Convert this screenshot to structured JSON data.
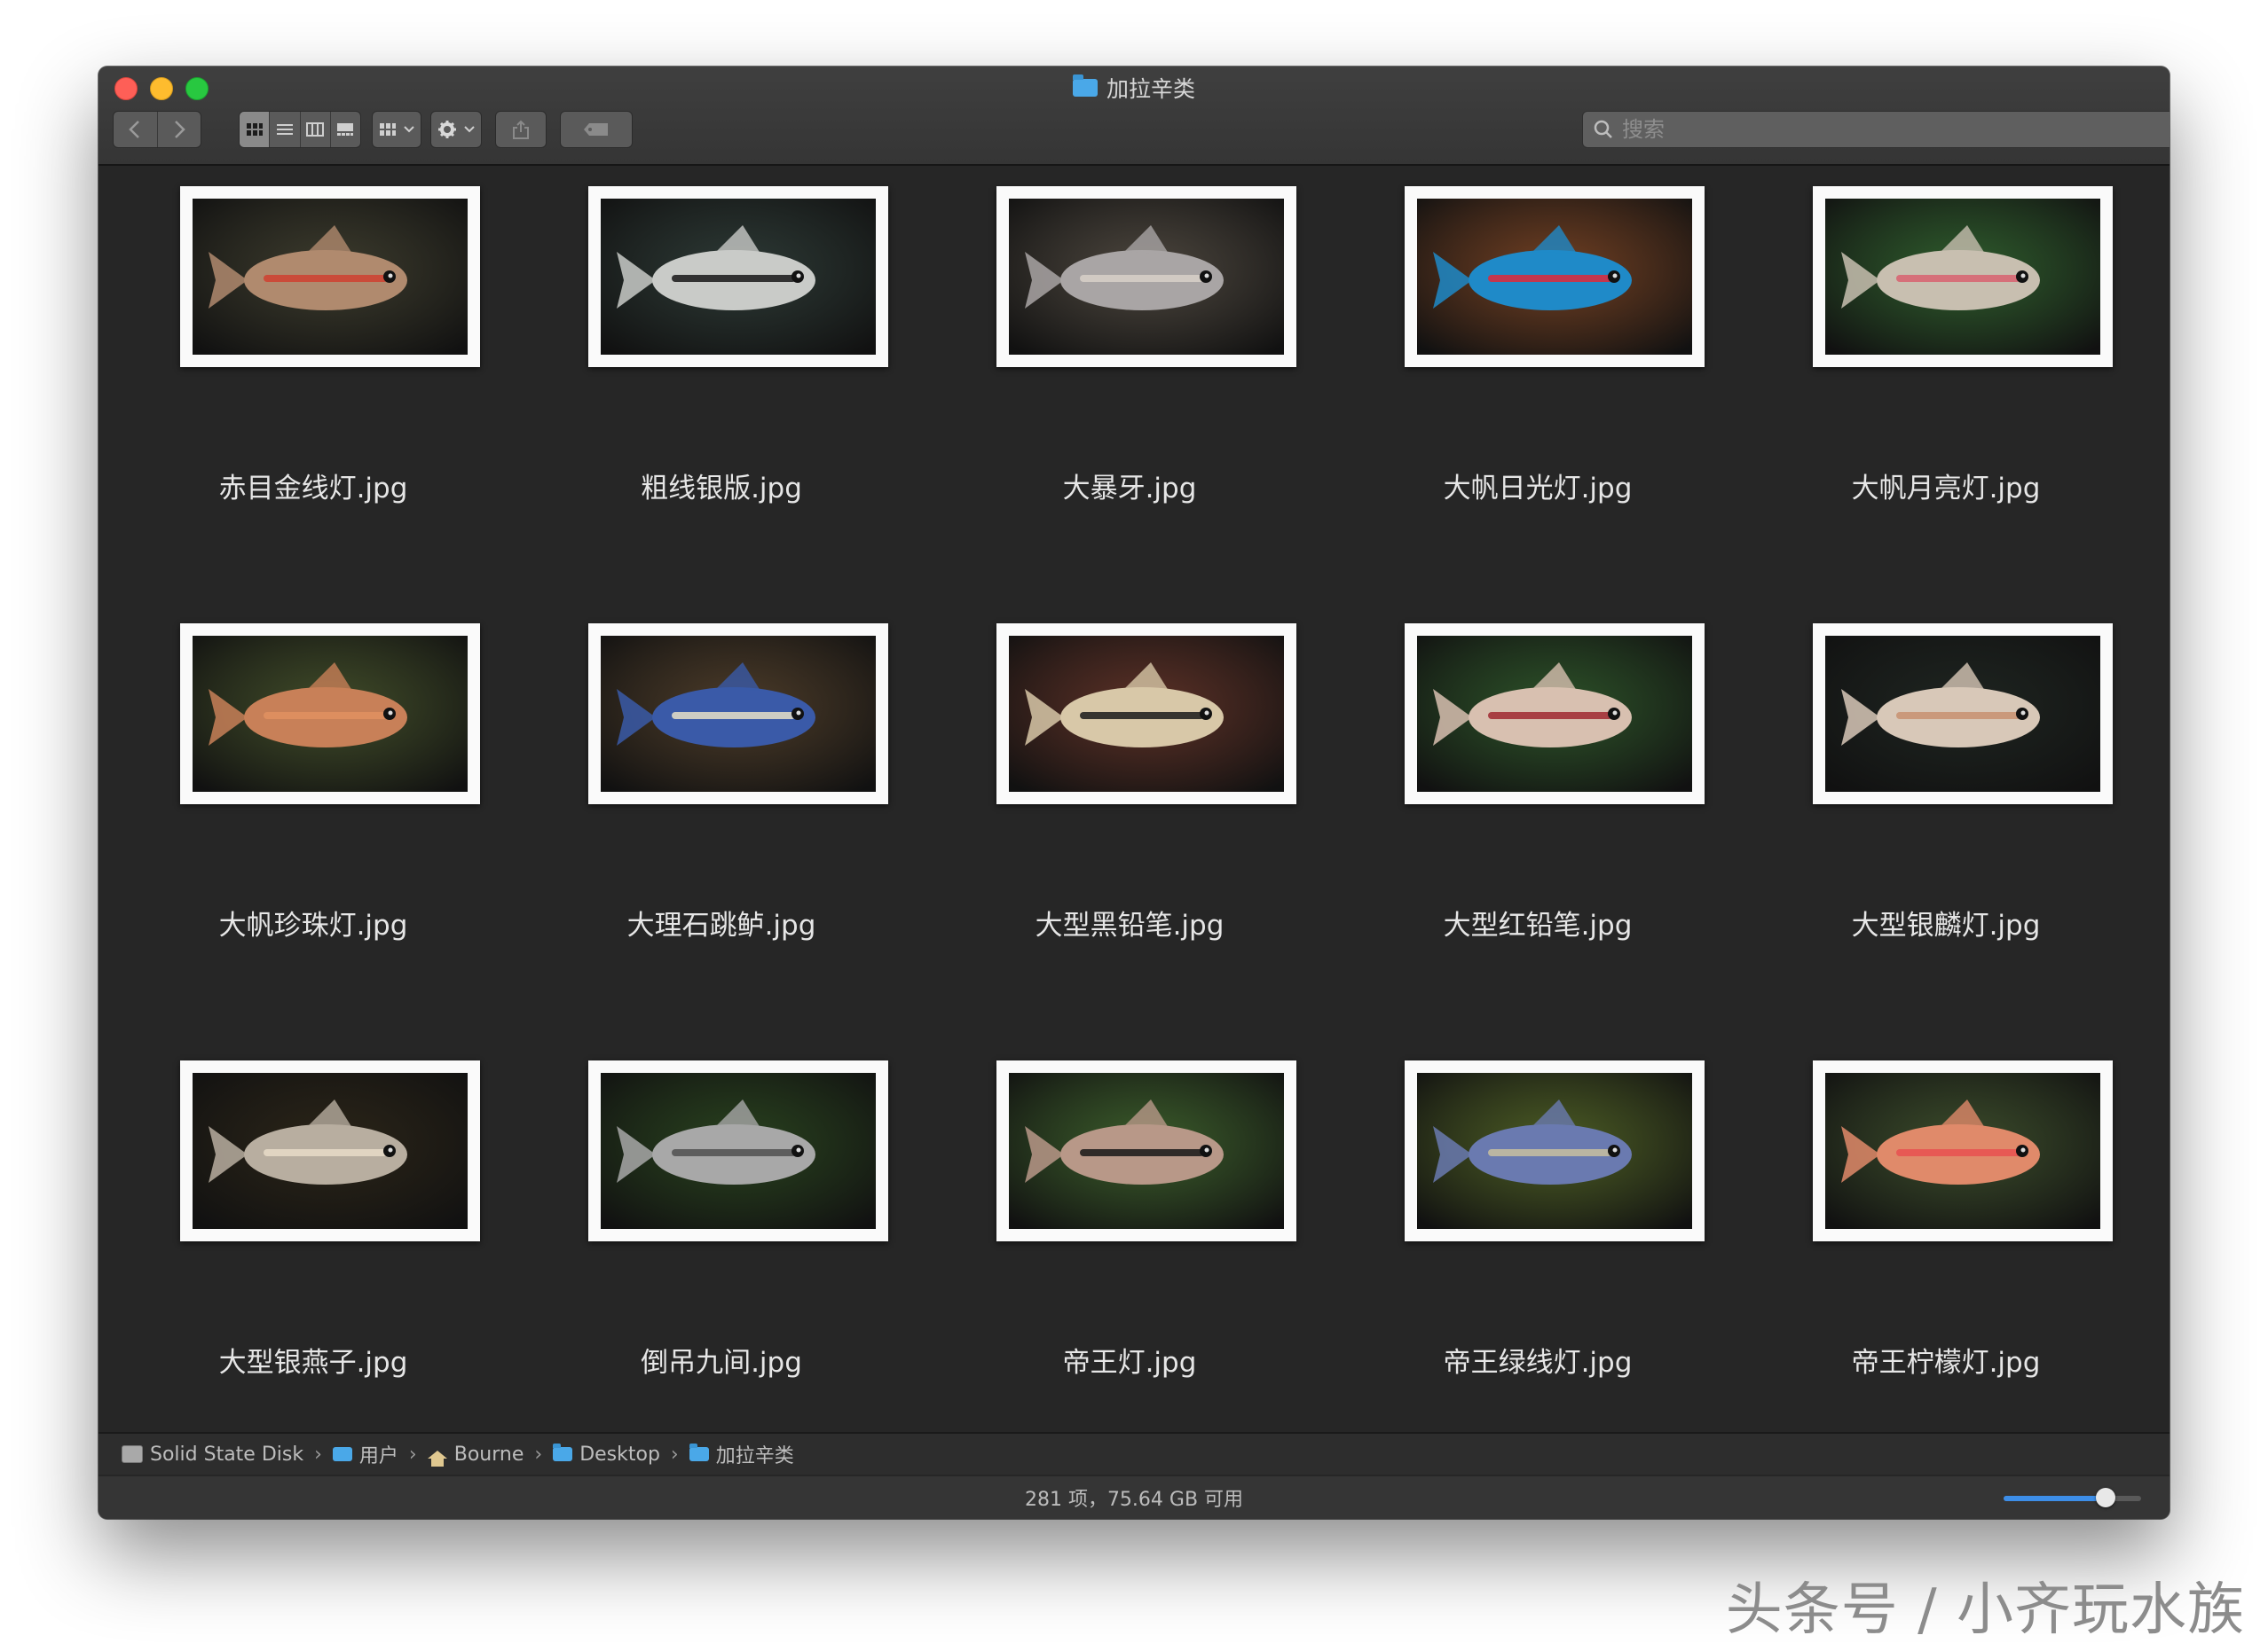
{
  "window": {
    "title": "加拉辛类",
    "search_placeholder": "搜索"
  },
  "toolbar": {
    "back_icon": "chevron-left-icon",
    "forward_icon": "chevron-right-icon",
    "view_modes": [
      "icon-view-icon",
      "list-view-icon",
      "column-view-icon",
      "gallery-view-icon"
    ],
    "active_view": "icon"
  },
  "files": [
    {
      "name": "赤目金线灯.jpg",
      "colors": {
        "bg": "#3b3a2c",
        "fish": "#b08a6e",
        "accent": "#d04030"
      }
    },
    {
      "name": "粗线银版.jpg",
      "colors": {
        "bg": "#2c3834",
        "fish": "#c9cbc8",
        "accent": "#181818"
      }
    },
    {
      "name": "大暴牙.jpg",
      "colors": {
        "bg": "#4a443c",
        "fish": "#a9a5a5",
        "accent": "#d8d0c8"
      }
    },
    {
      "name": "大帆日光灯.jpg",
      "colors": {
        "bg": "#6e3e22",
        "fish": "#1f8ac8",
        "accent": "#e02838"
      }
    },
    {
      "name": "大帆月亮灯.jpg",
      "colors": {
        "bg": "#2e5a2c",
        "fish": "#c8bfb0",
        "accent": "#d86070"
      }
    },
    {
      "name": "大帆珍珠灯.jpg",
      "colors": {
        "bg": "#3f4a28",
        "fish": "#c88058",
        "accent": "#e09060"
      }
    },
    {
      "name": "大理石跳鲈.jpg",
      "colors": {
        "bg": "#4a3a28",
        "fish": "#3a5aa8",
        "accent": "#e8e0c8"
      }
    },
    {
      "name": "大型黑铅笔.jpg",
      "colors": {
        "bg": "#5a3026",
        "fish": "#d8c8a8",
        "accent": "#1a1a1a"
      }
    },
    {
      "name": "大型红铅笔.jpg",
      "colors": {
        "bg": "#2c5028",
        "fish": "#d8c0b0",
        "accent": "#a02830"
      }
    },
    {
      "name": "大型银麟灯.jpg",
      "colors": {
        "bg": "#1e2420",
        "fish": "#d8c8b8",
        "accent": "#c89070"
      }
    },
    {
      "name": "大型银燕子.jpg",
      "colors": {
        "bg": "#2a2418",
        "fish": "#b8aea0",
        "accent": "#e8dcc8"
      }
    },
    {
      "name": "倒吊九间.jpg",
      "colors": {
        "bg": "#28401e",
        "fish": "#a8a8a8",
        "accent": "#505050"
      }
    },
    {
      "name": "帝王灯.jpg",
      "colors": {
        "bg": "#3a5a2a",
        "fish": "#b89888",
        "accent": "#181818"
      }
    },
    {
      "name": "帝王绿线灯.jpg",
      "colors": {
        "bg": "#4a5a24",
        "fish": "#6a7ab0",
        "accent": "#c8c0a0"
      }
    },
    {
      "name": "帝王柠檬灯.jpg",
      "colors": {
        "bg": "#3a4a2a",
        "fish": "#e08a6a",
        "accent": "#e85050"
      }
    }
  ],
  "pathbar": [
    {
      "label": "Solid State Disk",
      "icon": "disk-icon"
    },
    {
      "label": "用户",
      "icon": "users-folder-icon"
    },
    {
      "label": "Bourne",
      "icon": "home-icon"
    },
    {
      "label": "Desktop",
      "icon": "folder-icon"
    },
    {
      "label": "加拉辛类",
      "icon": "folder-icon"
    }
  ],
  "status": {
    "text": "281 项，75.64 GB 可用",
    "icon_size_level": 0.74
  },
  "watermark": "头条号 / 小齐玩水族"
}
